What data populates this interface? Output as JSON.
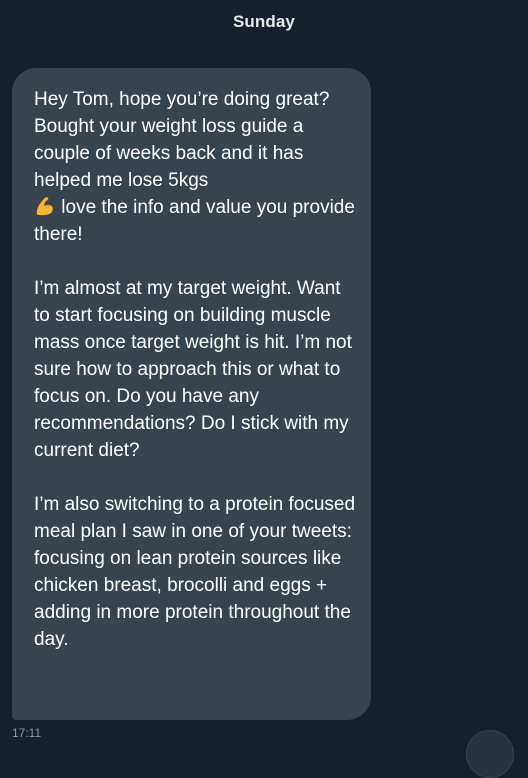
{
  "conversation": {
    "date_label": "Sunday",
    "message": {
      "paragraph_1_before_emoji": "Hey Tom, hope you’re doing great? Bought your weight loss guide a couple of weeks back and it has helped me lose 5kgs",
      "emoji_icon": "flexed-biceps-icon",
      "paragraph_1_after_emoji": " love the info and value you provide there!",
      "paragraph_2": "I’m almost at my target weight. Want to start focusing on building muscle mass once target weight is hit. I’m not sure how to approach this or what to focus on. Do you have any recommendations? Do I stick with my current diet?",
      "paragraph_3": "I’m also switching to a protein focused meal plan I saw in one of your tweets: focusing on lean protein sources like chicken breast, brocolli and eggs + adding in more protein throughout the day.",
      "timestamp": "17:11"
    },
    "colors": {
      "background": "#15202b",
      "bubble": "#38444d",
      "timestamp": "#8b98a5"
    }
  }
}
